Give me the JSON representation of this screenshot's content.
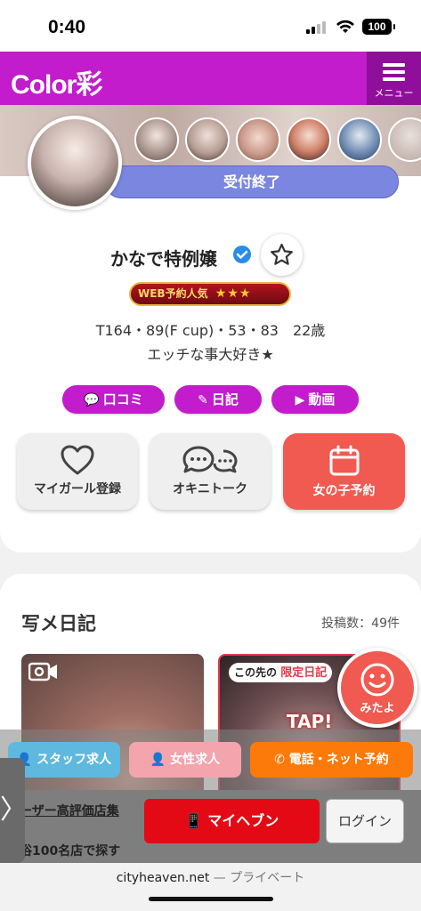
{
  "status_bar": {
    "time": "0:40",
    "battery": "100"
  },
  "header": {
    "logo": "Color彩",
    "menu_label": "メニュー"
  },
  "profile": {
    "status_text": "受付終了",
    "name": "かなで特例嬢",
    "badge_text": "WEB予約人気",
    "badge_stars": "★★★",
    "stats": "T164・89(F cup)・53・83　22歳",
    "tagline": "エッチな事大好き★"
  },
  "chips": {
    "kuchikomi": "口コミ",
    "diary": "日記",
    "video": "動画"
  },
  "actions": {
    "my_girl": "マイガール登録",
    "okini_talk": "オキニトーク",
    "reserve": "女の子予約"
  },
  "diary_section": {
    "title": "写メ日記",
    "count": "投稿数：49件",
    "limited_prefix": "この先の",
    "limited_label": "限定日記",
    "tap": "TAP!"
  },
  "floating": {
    "mitayo": "みたよ"
  },
  "recruit": {
    "staff": "スタッフ求人",
    "female": "女性求人",
    "call": "電話・ネット予約"
  },
  "bottom": {
    "promo1": "ーザー高評価店集",
    "promo2": "俗100名店で探す",
    "side_tab": "〉",
    "myheaven": "マイヘブン",
    "login": "ログイン"
  },
  "browser": {
    "domain": "cityheaven.net",
    "separator": " — ",
    "mode": "プライベート"
  },
  "colors": {
    "brand": "#c21ccc",
    "accent": "#f05a50",
    "status_pill": "#7a86e0",
    "call": "#fb7a0a",
    "myheaven": "#e30a16"
  }
}
